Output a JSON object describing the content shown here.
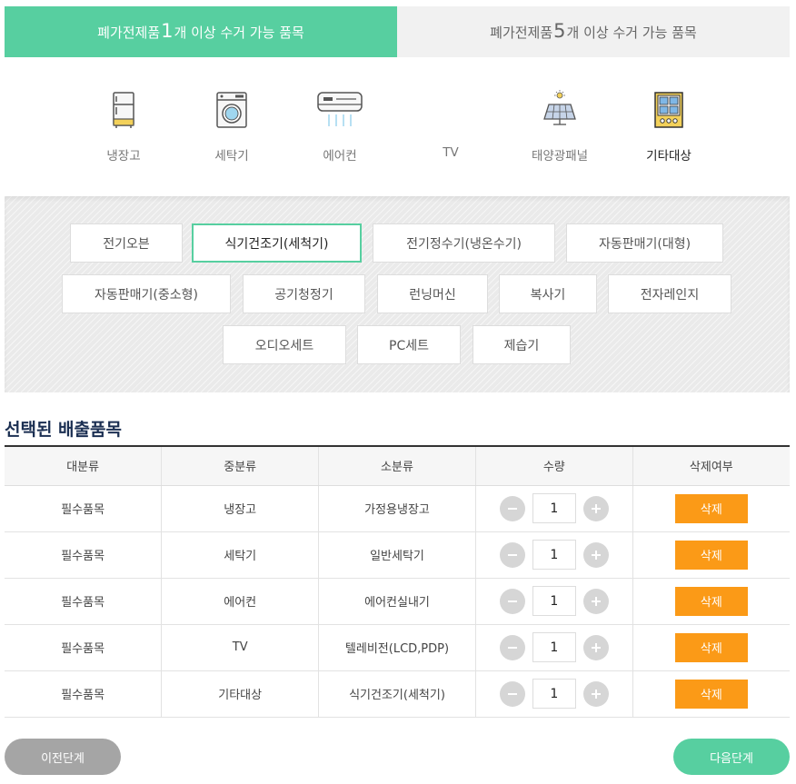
{
  "tabs": [
    {
      "prefix": "폐가전제품 ",
      "num": "1",
      "suffix": "개 이상 수거 가능 품목",
      "active": true
    },
    {
      "prefix": "폐가전제품 ",
      "num": "5",
      "suffix": "개 이상 수거 가능 품목",
      "active": false
    }
  ],
  "categories": [
    {
      "label": "냉장고",
      "icon": "refrigerator-icon"
    },
    {
      "label": "세탁기",
      "icon": "washing-machine-icon"
    },
    {
      "label": "에어컨",
      "icon": "air-conditioner-icon"
    },
    {
      "label": "TV",
      "icon": "tv-icon"
    },
    {
      "label": "태양광패널",
      "icon": "solar-panel-icon"
    },
    {
      "label": "기타대상",
      "icon": "other-appliance-icon",
      "active": true
    }
  ],
  "sub_items": [
    "전기오븐",
    "식기건조기(세척기)",
    "전기정수기(냉온수기)",
    "자동판매기(대형)",
    "자동판매기(중소형)",
    "공기청정기",
    "런닝머신",
    "복사기",
    "전자레인지",
    "오디오세트",
    "PC세트",
    "제습기"
  ],
  "selected_sub_item": "식기건조기(세척기)",
  "section_title": "선택된 배출품목",
  "table": {
    "headers": [
      "대분류",
      "중분류",
      "소분류",
      "수량",
      "삭제여부"
    ],
    "rows": [
      {
        "major": "필수품목",
        "middle": "냉장고",
        "minor": "가정용냉장고",
        "qty": "1",
        "delete": "삭제"
      },
      {
        "major": "필수품목",
        "middle": "세탁기",
        "minor": "일반세탁기",
        "qty": "1",
        "delete": "삭제"
      },
      {
        "major": "필수품목",
        "middle": "에어컨",
        "minor": "에어컨실내기",
        "qty": "1",
        "delete": "삭제"
      },
      {
        "major": "필수품목",
        "middle": "TV",
        "minor": "텔레비전(LCD,PDP)",
        "qty": "1",
        "delete": "삭제"
      },
      {
        "major": "필수품목",
        "middle": "기타대상",
        "minor": "식기건조기(세척기)",
        "qty": "1",
        "delete": "삭제"
      }
    ]
  },
  "buttons": {
    "prev": "이전단계",
    "next": "다음단계"
  },
  "colors": {
    "accent": "#57cfa0",
    "delete": "#fb9a17",
    "title": "#1b2f52",
    "prev": "#a5a5a5"
  }
}
